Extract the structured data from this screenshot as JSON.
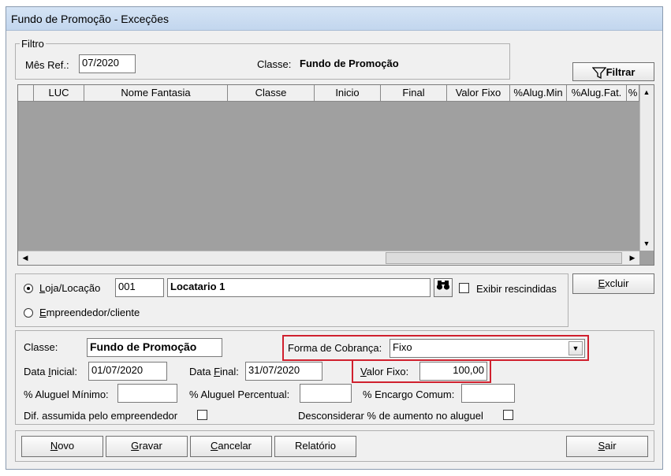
{
  "window": {
    "title": "Fundo de Promoção - Exceções"
  },
  "filter": {
    "group_label": "Filtro",
    "mes_ref_label": "Mês Ref.:",
    "mes_ref_value": "07/2020",
    "classe_label": "Classe:",
    "classe_value": "Fundo de Promoção",
    "filter_button": "Filtrar",
    "filter_icon": "funnel-icon"
  },
  "grid": {
    "columns": [
      "LUC",
      "Nome Fantasia",
      "Classe",
      "Inicio",
      "Final",
      "Valor Fixo",
      "%Alug.Min",
      "%Alug.Fat.",
      "%"
    ],
    "rows": []
  },
  "selection": {
    "loja_label_pre": "",
    "loja_label_u": "L",
    "loja_label_post": "oja/Locação",
    "loja_code": "001",
    "loja_name": "Locatario 1",
    "search_icon": "binoculars-icon",
    "exibir_rescindidas": "Exibir rescindidas",
    "empreendedor_u": "E",
    "empreendedor_post": "mpreendedor/cliente",
    "excluir_u": "E",
    "excluir_post": "xcluir"
  },
  "details": {
    "classe_label": "Classe:",
    "classe_value": "Fundo de Promoção",
    "forma_cobranca_label": "Forma de Cobrança:",
    "forma_cobranca_value": "Fixo",
    "data_inicial_pre": "Data ",
    "data_inicial_u": "I",
    "data_inicial_post": "nicial:",
    "data_inicial_value": "01/07/2020",
    "data_final_pre": "Data ",
    "data_final_u": "F",
    "data_final_post": "inal:",
    "data_final_value": "31/07/2020",
    "valor_fixo_u": "V",
    "valor_fixo_post": "alor Fixo:",
    "valor_fixo_value": "100,00",
    "aluguel_minimo_label": "% Aluguel Mínimo:",
    "aluguel_percentual_label": "% Aluguel Percentual:",
    "encargo_comum_label": "% Encargo Comum:",
    "dif_assumida_label": "Dif. assumida pelo empreendedor",
    "desconsiderar_label": "Desconsiderar % de aumento no aluguel"
  },
  "actions": {
    "novo_u": "N",
    "novo_post": "ovo",
    "gravar_u": "G",
    "gravar_post": "ravar",
    "cancelar_u": "C",
    "cancelar_post": "ancelar",
    "relatorio": "Relatório",
    "sair_u": "S",
    "sair_post": "air"
  }
}
